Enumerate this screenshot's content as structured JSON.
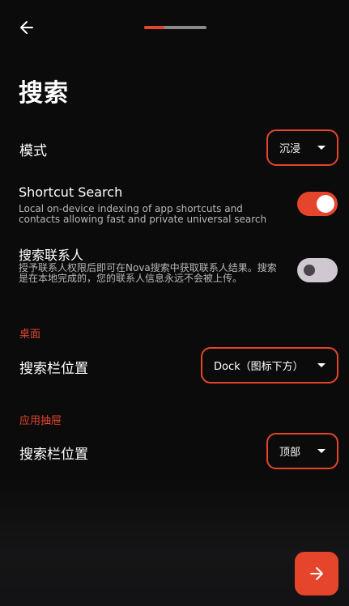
{
  "header": {
    "back_icon": "arrow-left-icon",
    "progress_fraction": 0.33
  },
  "colors": {
    "accent": "#e5452b",
    "background": "#0b0b0c"
  },
  "page_title": "搜索",
  "mode": {
    "label": "模式",
    "value": "沉浸"
  },
  "shortcut_search": {
    "title": "Shortcut Search",
    "description": "Local on-device indexing of app shortcuts and contacts allowing fast and private universal search",
    "enabled": true
  },
  "search_contacts": {
    "title": "搜索联系人",
    "description": "授予联系人权限后即可在Nova搜索中获取联系人结果。搜索是在本地完成的，您的联系人信息永远不会被上传。",
    "enabled": false
  },
  "desktop_section": {
    "header": "桌面",
    "search_bar_label": "搜索栏位置",
    "search_bar_value": "Dock（图标下方）"
  },
  "drawer_section": {
    "header": "应用抽屉",
    "search_bar_label": "搜索栏位置",
    "search_bar_value": "顶部"
  },
  "fab": {
    "icon": "arrow-right-icon"
  }
}
